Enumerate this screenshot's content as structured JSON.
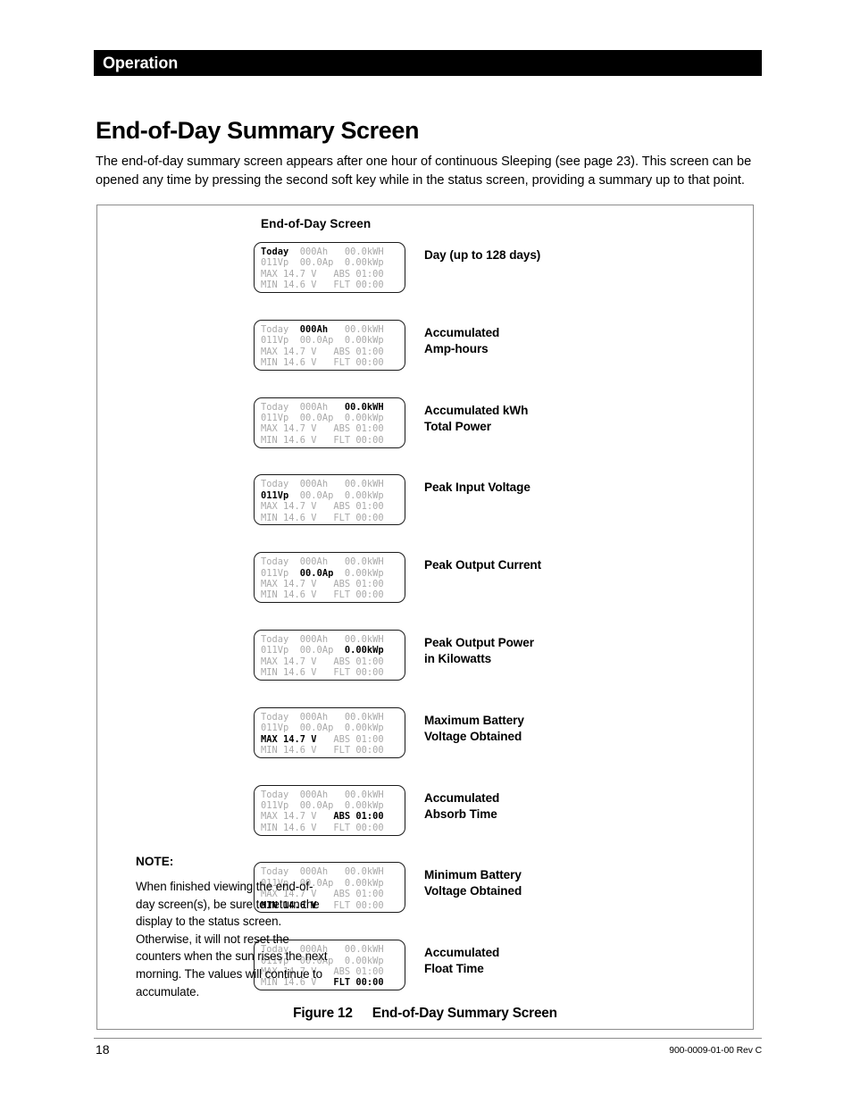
{
  "header": {
    "section_title": "Operation"
  },
  "page_title": "End-of-Day Summary Screen",
  "intro_paragraph": "The end-of-day summary screen appears after one hour of continuous Sleeping (see page 23).  This screen can be opened any time by pressing the second soft key while in the status screen, providing a summary up to that point.",
  "figure": {
    "screen_group_title": "End-of-Day  Screen",
    "caption_number": "Figure 12",
    "caption_text": "End-of-Day Summary Screen",
    "panels": [
      {
        "name": "day-counter",
        "label_line1": "Day (up to 128 days)",
        "label_line2": "",
        "lines": [
          [
            {
              "t": "Today",
              "hl": true
            },
            {
              "t": "  000Ah   00.0kWH",
              "hl": false
            }
          ],
          [
            {
              "t": "011Vp  00.0Ap  0.00kWp",
              "hl": false
            }
          ],
          [
            {
              "t": "MAX 14.7 V   ABS 01:00",
              "hl": false
            }
          ],
          [
            {
              "t": "MIN 14.6 V   FLT 00:00",
              "hl": false
            }
          ]
        ]
      },
      {
        "name": "accumulated-amp-hours",
        "label_line1": "Accumulated",
        "label_line2": "Amp-hours",
        "lines": [
          [
            {
              "t": "Today  ",
              "hl": false
            },
            {
              "t": "000Ah",
              "hl": true
            },
            {
              "t": "   00.0kWH",
              "hl": false
            }
          ],
          [
            {
              "t": "011Vp  00.0Ap  0.00kWp",
              "hl": false
            }
          ],
          [
            {
              "t": "MAX 14.7 V   ABS 01:00",
              "hl": false
            }
          ],
          [
            {
              "t": "MIN 14.6 V   FLT 00:00",
              "hl": false
            }
          ]
        ]
      },
      {
        "name": "accumulated-kwh-total-power",
        "label_line1": "Accumulated kWh",
        "label_line2": "Total Power",
        "lines": [
          [
            {
              "t": "Today  000Ah   ",
              "hl": false
            },
            {
              "t": "00.0kWH",
              "hl": true
            }
          ],
          [
            {
              "t": "011Vp  00.0Ap  0.00kWp",
              "hl": false
            }
          ],
          [
            {
              "t": "MAX 14.7 V   ABS 01:00",
              "hl": false
            }
          ],
          [
            {
              "t": "MIN 14.6 V   FLT 00:00",
              "hl": false
            }
          ]
        ]
      },
      {
        "name": "peak-input-voltage",
        "label_line1": "Peak Input Voltage",
        "label_line2": "",
        "lines": [
          [
            {
              "t": "Today  000Ah   00.0kWH",
              "hl": false
            }
          ],
          [
            {
              "t": "011Vp",
              "hl": true
            },
            {
              "t": "  00.0Ap  0.00kWp",
              "hl": false
            }
          ],
          [
            {
              "t": "MAX 14.7 V   ABS 01:00",
              "hl": false
            }
          ],
          [
            {
              "t": "MIN 14.6 V   FLT 00:00",
              "hl": false
            }
          ]
        ]
      },
      {
        "name": "peak-output-current",
        "label_line1": "Peak Output Current",
        "label_line2": "",
        "lines": [
          [
            {
              "t": "Today  000Ah   00.0kWH",
              "hl": false
            }
          ],
          [
            {
              "t": "011Vp  ",
              "hl": false
            },
            {
              "t": "00.0Ap",
              "hl": true
            },
            {
              "t": "  0.00kWp",
              "hl": false
            }
          ],
          [
            {
              "t": "MAX 14.7 V   ABS 01:00",
              "hl": false
            }
          ],
          [
            {
              "t": "MIN 14.6 V   FLT 00:00",
              "hl": false
            }
          ]
        ]
      },
      {
        "name": "peak-output-power-kilowatts",
        "label_line1": "Peak Output Power",
        "label_line2": "in Kilowatts",
        "lines": [
          [
            {
              "t": "Today  000Ah   00.0kWH",
              "hl": false
            }
          ],
          [
            {
              "t": "011Vp  00.0Ap  ",
              "hl": false
            },
            {
              "t": "0.00kWp",
              "hl": true
            }
          ],
          [
            {
              "t": "MAX 14.7 V   ABS 01:00",
              "hl": false
            }
          ],
          [
            {
              "t": "MIN 14.6 V   FLT 00:00",
              "hl": false
            }
          ]
        ]
      },
      {
        "name": "maximum-battery-voltage",
        "label_line1": "Maximum Battery",
        "label_line2": "Voltage Obtained",
        "lines": [
          [
            {
              "t": "Today  000Ah   00.0kWH",
              "hl": false
            }
          ],
          [
            {
              "t": "011Vp  00.0Ap  0.00kWp",
              "hl": false
            }
          ],
          [
            {
              "t": "MAX 14.7 V",
              "hl": true
            },
            {
              "t": "   ABS 01:00",
              "hl": false
            }
          ],
          [
            {
              "t": "MIN 14.6 V   FLT 00:00",
              "hl": false
            }
          ]
        ]
      },
      {
        "name": "accumulated-absorb-time",
        "label_line1": "Accumulated",
        "label_line2": "Absorb Time",
        "lines": [
          [
            {
              "t": "Today  000Ah   00.0kWH",
              "hl": false
            }
          ],
          [
            {
              "t": "011Vp  00.0Ap  0.00kWp",
              "hl": false
            }
          ],
          [
            {
              "t": "MAX 14.7 V   ",
              "hl": false
            },
            {
              "t": "ABS 01:00",
              "hl": true
            }
          ],
          [
            {
              "t": "MIN 14.6 V   FLT 00:00",
              "hl": false
            }
          ]
        ]
      },
      {
        "name": "minimum-battery-voltage",
        "label_line1": "Minimum Battery",
        "label_line2": "Voltage Obtained",
        "lines": [
          [
            {
              "t": "Today  000Ah   00.0kWH",
              "hl": false
            }
          ],
          [
            {
              "t": "011Vp  00.0Ap  0.00kWp",
              "hl": false
            }
          ],
          [
            {
              "t": "MAX 14.7 V   ABS 01:00",
              "hl": false
            }
          ],
          [
            {
              "t": "MIN 14.6 V",
              "hl": true
            },
            {
              "t": "   FLT 00:00",
              "hl": false
            }
          ]
        ]
      },
      {
        "name": "accumulated-float-time",
        "label_line1": "Accumulated",
        "label_line2": "Float Time",
        "lines": [
          [
            {
              "t": "Today  000Ah   00.0kWH",
              "hl": false
            }
          ],
          [
            {
              "t": "011Vp  00.0Ap  0.00kWp",
              "hl": false
            }
          ],
          [
            {
              "t": "MAX 14.7 V   ABS 01:00",
              "hl": false
            }
          ],
          [
            {
              "t": "MIN 14.6 V   ",
              "hl": false
            },
            {
              "t": "FLT 00:00",
              "hl": true
            }
          ]
        ]
      }
    ]
  },
  "note": {
    "heading": "NOTE:",
    "body": "When finished viewing the end-of-day screen(s), be sure to return the display to the status screen.  Otherwise, it will not reset the counters when the sun rises the next morning.  The values will continue to accumulate."
  },
  "footer": {
    "page_number": "18",
    "document_number": "900-0009-01-00 Rev C"
  },
  "colors": {
    "header_band": "#000000",
    "lcd_dim_text": "#a9a9a9",
    "lcd_highlight_text": "#000000",
    "rule": "#8c8c8c"
  }
}
